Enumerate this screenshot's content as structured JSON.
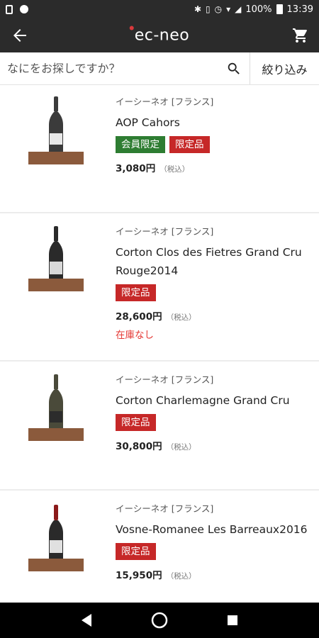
{
  "status_bar": {
    "battery": "100%",
    "time": "13:39"
  },
  "app_bar": {
    "logo": "ec-neo",
    "accent_color": "#d9393c"
  },
  "search": {
    "placeholder": "なにをお探しですか？",
    "filter_label": "絞り込み"
  },
  "products": [
    {
      "maker": "イーシーネオ [フランス]",
      "name": "AOP Cahors",
      "badges": [
        "会員限定",
        "限定品"
      ],
      "price": "3,080円",
      "tax": "（税込）",
      "stock": "",
      "bottle_color": "#3b3b3b"
    },
    {
      "maker": "イーシーネオ [フランス]",
      "name": "Corton Clos des Fietres Grand Cru Rouge2014",
      "badges": [
        "限定品"
      ],
      "price": "28,600円",
      "tax": "（税込）",
      "stock": "在庫なし",
      "bottle_color": "#2a2a2a"
    },
    {
      "maker": "イーシーネオ [フランス]",
      "name": "Corton Charlemagne Grand Cru",
      "badges": [
        "限定品"
      ],
      "price": "30,800円",
      "tax": "（税込）",
      "stock": "",
      "bottle_color": "#4a4a3a"
    },
    {
      "maker": "イーシーネオ [フランス]",
      "name": "Vosne-Romanee Les Barreaux2016",
      "badges": [
        "限定品"
      ],
      "price": "15,950円",
      "tax": "（税込）",
      "stock": "",
      "bottle_color": "#2a2a2a"
    }
  ]
}
